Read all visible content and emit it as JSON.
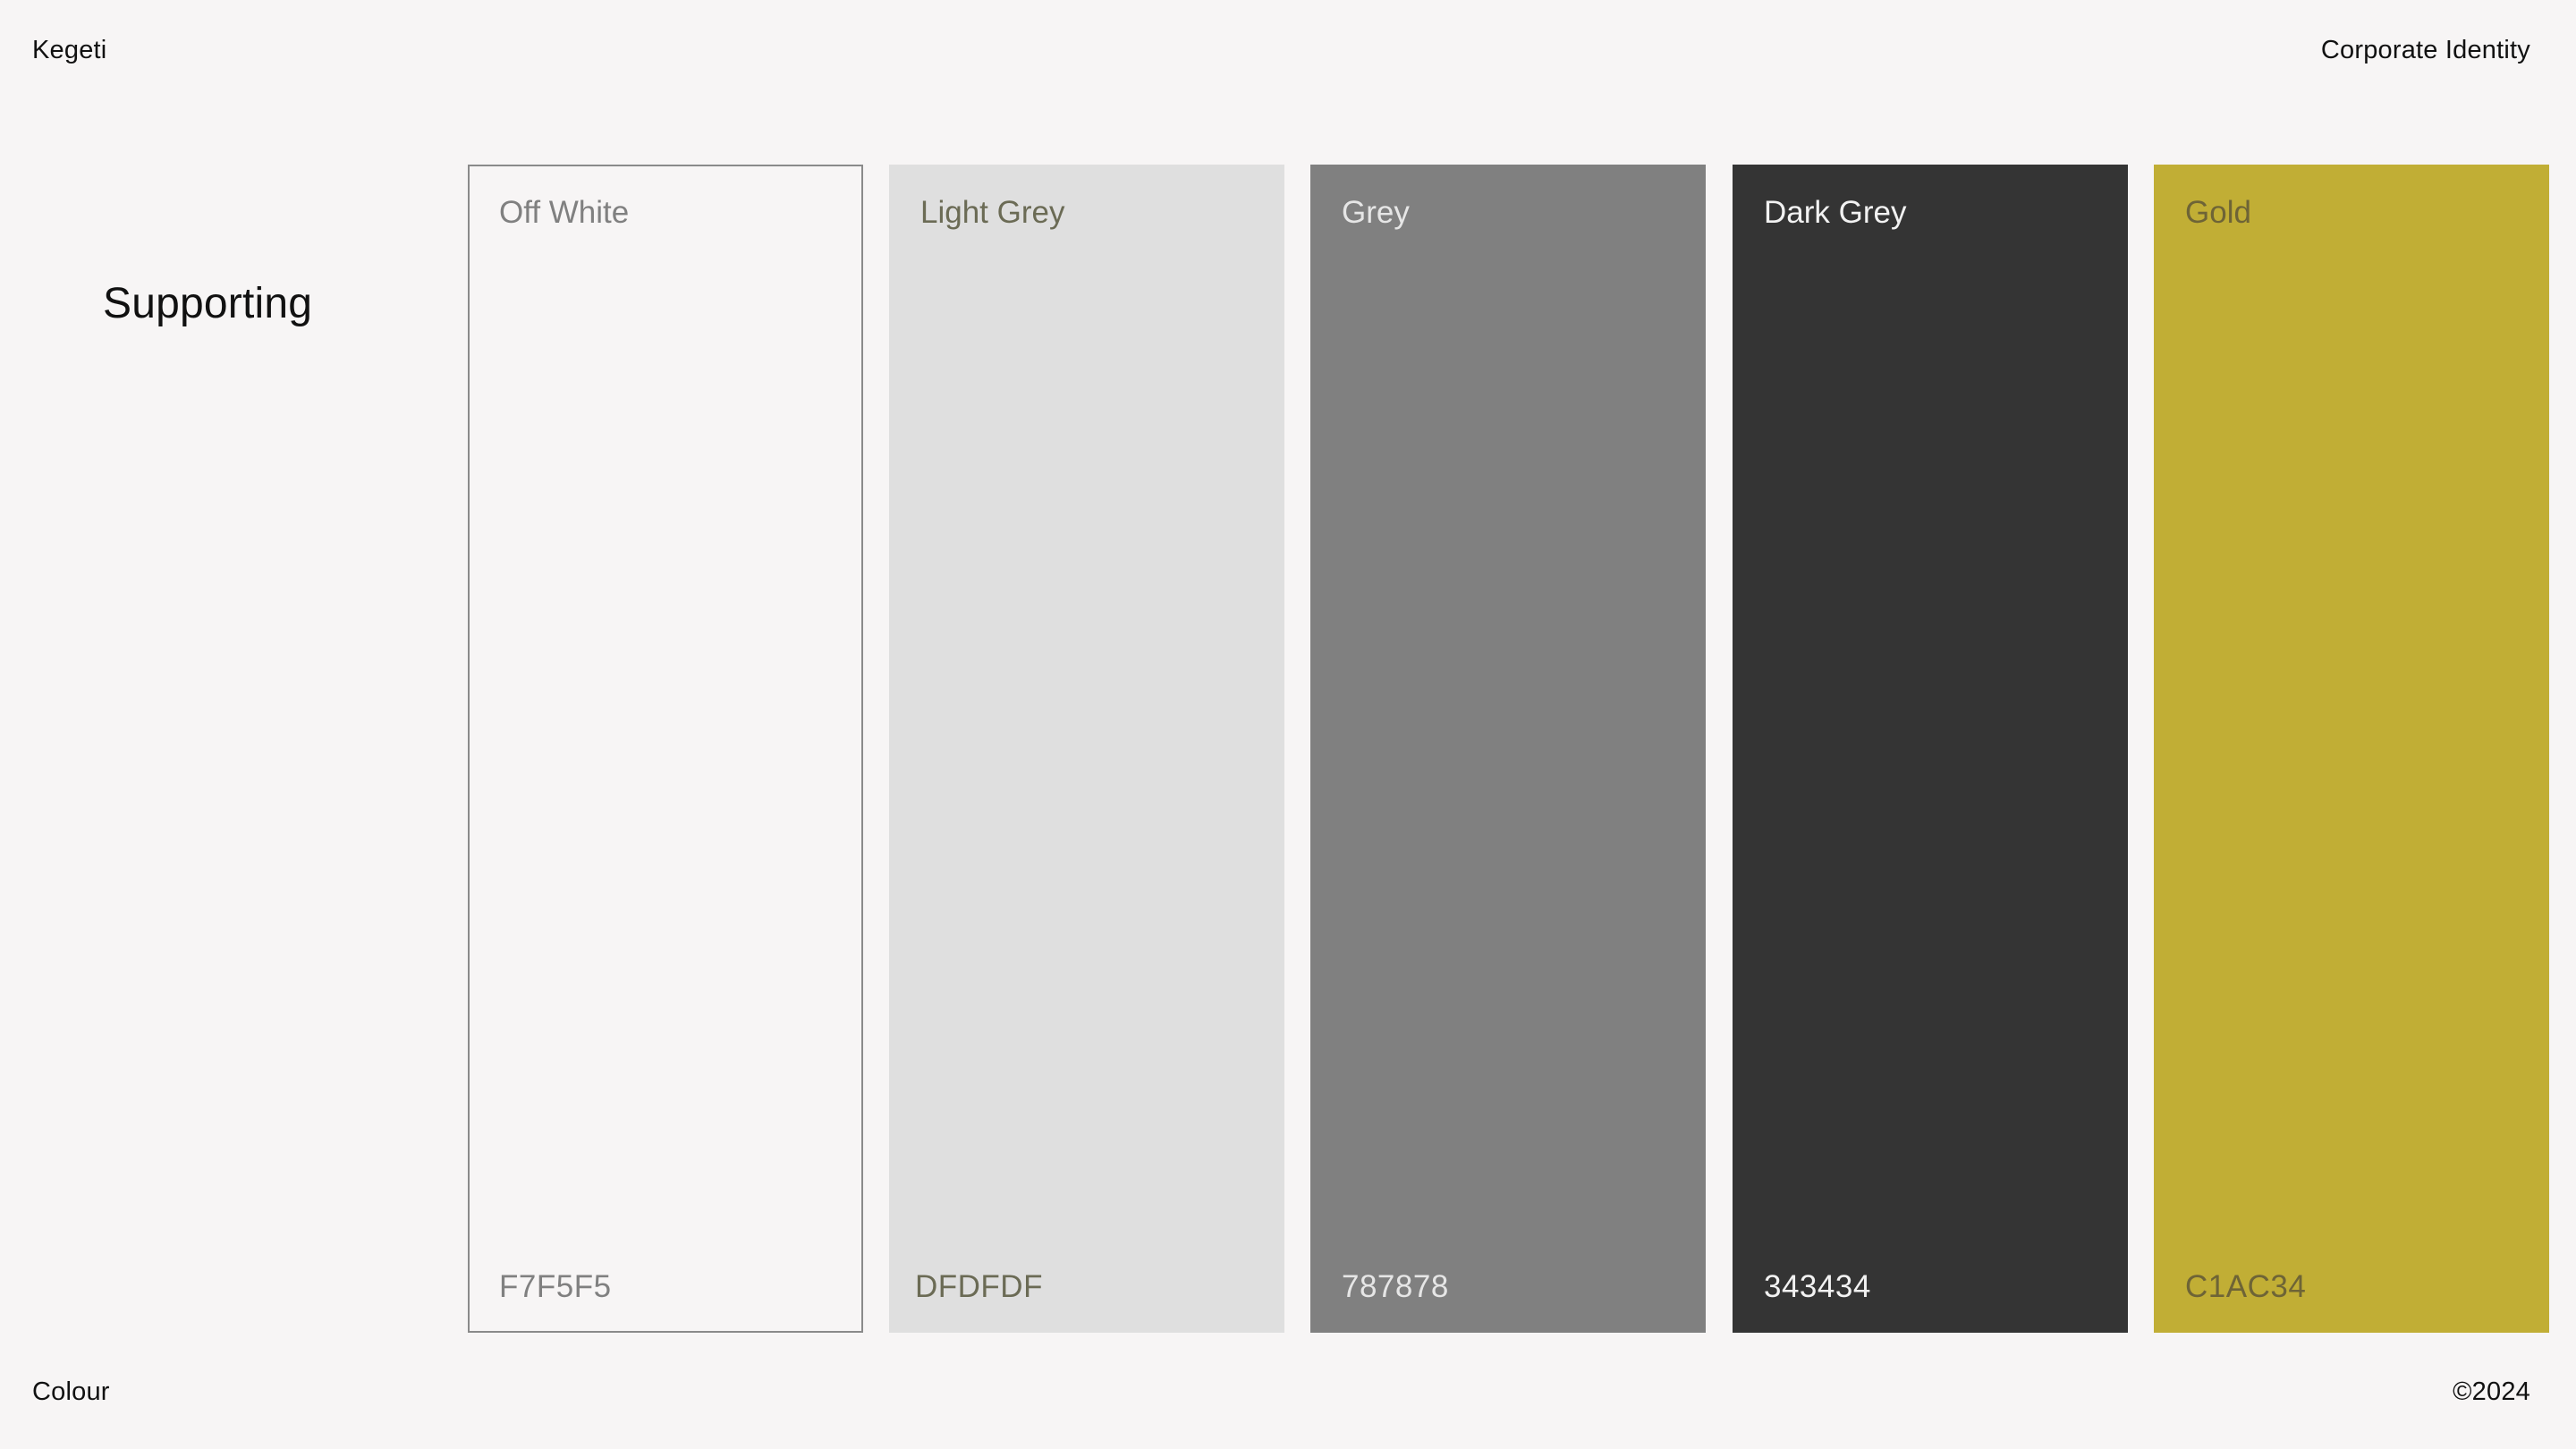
{
  "header": {
    "brand": "Kegeti",
    "document": "Corporate Identity"
  },
  "footer": {
    "section": "Colour",
    "copyright": "©2024"
  },
  "heading": "Supporting",
  "swatches": [
    {
      "name": "Off White",
      "hex": "F7F5F5",
      "color": "#F7F5F5",
      "text_color": "#808080"
    },
    {
      "name": "Light Grey",
      "hex": "DFDFDF",
      "color": "#DFDFDF",
      "text_color": "#6B6B55"
    },
    {
      "name": "Grey",
      "hex": "787878",
      "color": "#808080",
      "text_color": "#E6E6E6"
    },
    {
      "name": "Dark Grey",
      "hex": "343434",
      "color": "#343434",
      "text_color": "#F2F2F2"
    },
    {
      "name": "Gold",
      "hex": "C1AC34",
      "color": "#C1AE35",
      "text_color": "#6E6436"
    }
  ]
}
